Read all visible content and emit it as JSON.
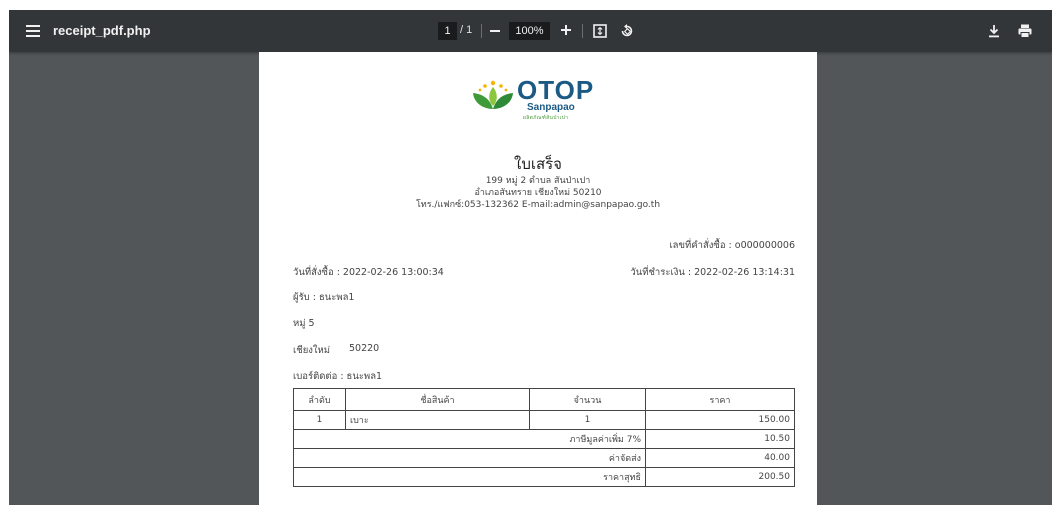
{
  "toolbar": {
    "title": "receipt_pdf.php",
    "page_current": "1",
    "page_total": "/ 1",
    "zoom": "100%",
    "icons": [
      "menu-icon",
      "zoom-out-icon",
      "zoom-in-icon",
      "fit-page-icon",
      "rotate-icon",
      "download-icon",
      "print-icon"
    ]
  },
  "logo": {
    "name": "OTOP",
    "sub": "Sanpapao",
    "tagline": "ผลิตภัณฑ์สันป่าเปา"
  },
  "receipt": {
    "title": "ใบเสร็จ",
    "address_line1": "199 หมู่ 2 ตำบล สันป่าเปา",
    "address_line2": "อำเภอสันทราย เชียงใหม่ 50210",
    "contact": "โทร./แฟกซ์:053-132362  E-mail:admin@sanpapao.go.th",
    "order_no": "เลขที่คำสั่งซื้อ : o000000006",
    "order_date": "วันที่สั่งซื้อ : 2022-02-26 13:00:34",
    "paid_date": "วันที่ชำระเงิน : 2022-02-26 13:14:31",
    "recipient": "ผู้รับ : ธนะพล1",
    "village": "หมู่ 5",
    "province": "เชียงใหม่",
    "postcode": "50220",
    "phone": "เบอร์ติดต่อ : ธนะพล1"
  },
  "table": {
    "headers": [
      "ลำดับ",
      "ชื่อสินค้า",
      "จำนวน",
      "ราคา"
    ],
    "rows": [
      {
        "no": "1",
        "name": "เบาะ",
        "qty": "1",
        "price": "150.00"
      }
    ],
    "vat_label": "ภาษีมูลค่าเพิ่ม 7%",
    "vat_value": "10.50",
    "shipping_label": "ค่าจัดส่ง",
    "shipping_value": "40.00",
    "net_label": "ราคาสุทธิ",
    "net_value": "200.50"
  },
  "colors": {
    "toolbar": "#323639",
    "viewer_bg": "#525659",
    "brand_blue": "#1b5a84",
    "brand_green": "#4a9a3a"
  }
}
